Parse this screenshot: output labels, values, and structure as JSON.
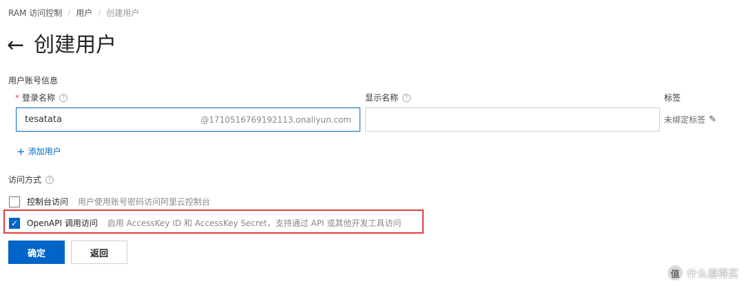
{
  "breadcrumb": {
    "items": [
      "RAM 访问控制",
      "用户",
      "创建用户"
    ],
    "separator": "/"
  },
  "page": {
    "back_icon": "←",
    "title": "创建用户"
  },
  "account_section": {
    "heading": "用户账号信息",
    "login_name": {
      "label": "登录名称",
      "required_mark": "*",
      "value": "tesatata",
      "suffix": "@1710516769192113.onaliyun.com"
    },
    "display_name": {
      "label": "显示名称",
      "value": ""
    },
    "tags": {
      "label": "标签",
      "value": "未绑定标签",
      "edit_icon": "✎"
    },
    "add_user_plus": "+",
    "add_user_label": "添加用户"
  },
  "access_section": {
    "heading": "访问方式",
    "options": [
      {
        "label": "控制台访问",
        "description": "用户使用账号密码访问阿里云控制台",
        "checked": false
      },
      {
        "label": "OpenAPI 调用访问",
        "description": "启用 AccessKey ID 和 AccessKey Secret，支持通过 API 或其他开发工具访问",
        "checked": true,
        "check_glyph": "✓"
      }
    ]
  },
  "help_glyph": "?",
  "buttons": {
    "confirm": "确定",
    "back": "返回"
  },
  "watermark": {
    "logo": "值",
    "text": "什么值得买"
  },
  "colors": {
    "primary": "#0064c8",
    "highlight_border": "#e5393b",
    "required": "#e64a35"
  }
}
